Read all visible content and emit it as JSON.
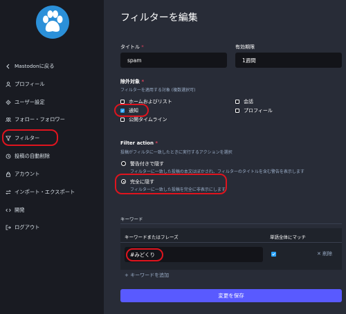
{
  "sidebar": {
    "items": [
      {
        "icon": "chevron-left-icon",
        "label": "Mastodonに戻る"
      },
      {
        "icon": "person-icon",
        "label": "プロフィール"
      },
      {
        "icon": "gear-icon",
        "label": "ユーザー設定"
      },
      {
        "icon": "users-icon",
        "label": "フォロー・フォロワー"
      },
      {
        "icon": "filter-icon",
        "label": "フィルター"
      },
      {
        "icon": "history-icon",
        "label": "投稿の自動削除"
      },
      {
        "icon": "lock-icon",
        "label": "アカウント"
      },
      {
        "icon": "exchange-icon",
        "label": "インポート・エクスポート"
      },
      {
        "icon": "code-icon",
        "label": "開発"
      },
      {
        "icon": "logout-icon",
        "label": "ログアウト"
      }
    ]
  },
  "page": {
    "title": "フィルターを編集"
  },
  "form": {
    "title_label": "タイトル",
    "title_required": "*",
    "title_value": "spam",
    "expires_label": "有効期限",
    "expires_value": "1週間",
    "context_label": "除外対象",
    "context_required": "*",
    "context_hint": "フィルターを適用する対象 (複数選択可)",
    "contexts": [
      {
        "label": "ホームおよびリスト",
        "checked": false
      },
      {
        "label": "通知",
        "checked": true
      },
      {
        "label": "公開タイムライン",
        "checked": false
      },
      {
        "label": "会話",
        "checked": false
      },
      {
        "label": "プロフィール",
        "checked": false
      }
    ],
    "action_label": "Filter action",
    "action_required": "*",
    "action_hint": "投稿がフィルタに一致したときに実行するアクションを選択",
    "actions": [
      {
        "label": "警告付きで隠す",
        "hint": "フィルターに一致した投稿の本文はぼかされ、フィルターのタイトルを含む警告を表示します",
        "selected": false
      },
      {
        "label": "完全に隠す",
        "hint": "フィルターに一致した投稿を完全に非表示にします",
        "selected": true
      }
    ]
  },
  "keywords": {
    "section_title": "キーワード",
    "col_phrase": "キーワードまたはフレーズ",
    "col_whole_word": "単語全体にマッチ",
    "rows": [
      {
        "phrase": "#みどくり",
        "whole_word": true,
        "delete_label": "削除"
      }
    ],
    "add_label": "キーワードを追加"
  },
  "save_label": "変更を保存",
  "colors": {
    "accent": "#595aff",
    "checkbox": "#2aa3ff",
    "annotation": "#e0141e",
    "required": "#df405a"
  }
}
